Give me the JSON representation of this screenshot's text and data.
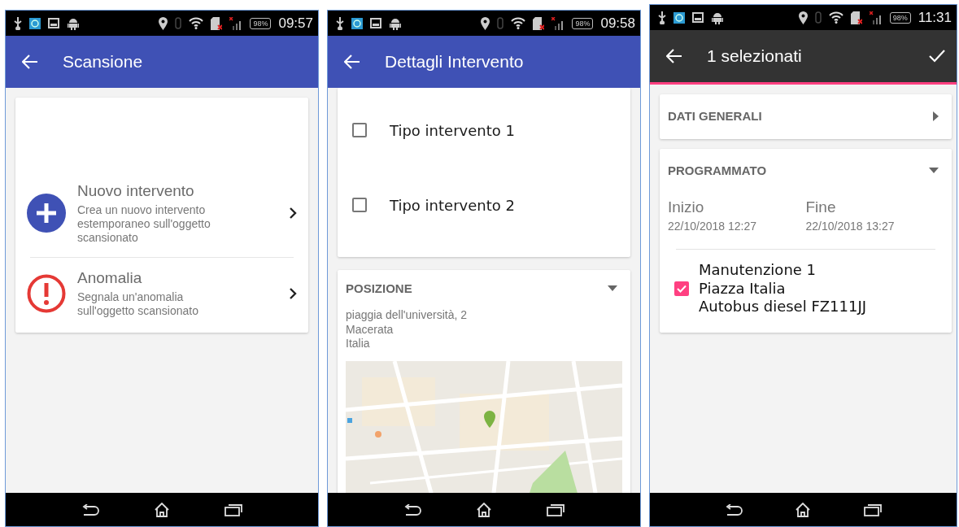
{
  "screens": [
    {
      "kind": "scan",
      "status": {
        "battery": "98%",
        "time": "09:57"
      },
      "appbar": {
        "kind": "primary",
        "title": "Scansione"
      },
      "options": [
        {
          "kind": "add",
          "title": "Nuovo intervento",
          "description": "Crea un nuovo intervento estemporaneo sull'oggetto scansionato"
        },
        {
          "kind": "warning",
          "title": "Anomalia",
          "description": "Segnala un'anomalia sull'oggetto scansionato"
        }
      ]
    },
    {
      "kind": "details",
      "status": {
        "battery": "98%",
        "time": "09:58"
      },
      "appbar": {
        "kind": "primary",
        "title": "Dettagli Intervento"
      },
      "checklist": [
        {
          "label": "Tipo intervento 1",
          "checked": false
        },
        {
          "label": "Tipo intervento 2",
          "checked": false
        }
      ],
      "position": {
        "heading": "POSIZIONE",
        "expanded": true,
        "address": [
          "piaggia dell'università, 2",
          "Macerata",
          "Italia"
        ]
      }
    },
    {
      "kind": "selection",
      "status": {
        "battery": "98%",
        "time": "11:31"
      },
      "appbar": {
        "kind": "selection",
        "title": "1 selezionati",
        "confirm": true
      },
      "sections": [
        {
          "heading": "DATI GENERALI",
          "expanded": false
        },
        {
          "heading": "PROGRAMMATO",
          "expanded": true,
          "start": {
            "label": "Inizio",
            "value": "22/10/2018 12:27"
          },
          "end": {
            "label": "Fine",
            "value": "22/10/2018 13:27"
          },
          "items": [
            {
              "lines": [
                "Manutenzione 1",
                "Piazza Italia",
                "Autobus diesel FZ111JJ"
              ],
              "checked": true
            }
          ]
        }
      ]
    }
  ]
}
